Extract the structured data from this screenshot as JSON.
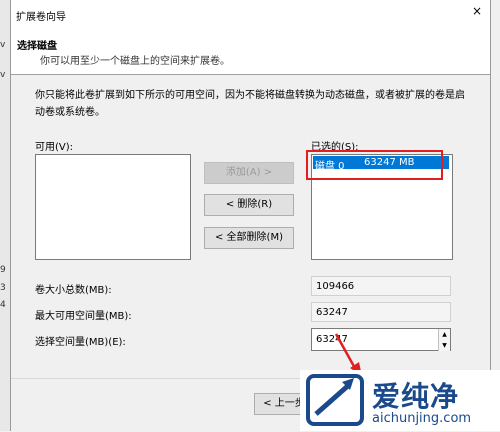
{
  "window": {
    "title": "扩展卷向导",
    "close_glyph": "×"
  },
  "header": {
    "title": "选择磁盘",
    "subtitle": "你可以用至少一个磁盘上的空间来扩展卷。"
  },
  "description": "你只能将此卷扩展到如下所示的可用空间，因为不能将磁盘转换为动态磁盘，或者被扩展的卷是启动卷或系统卷。",
  "available": {
    "label": "可用(V):",
    "items": []
  },
  "selected": {
    "label": "已选的(S):",
    "items": [
      {
        "disk": "磁盘 0",
        "size": "63247 MB"
      }
    ]
  },
  "buttons": {
    "add": "添加(A) >",
    "remove": "< 删除(R)",
    "remove_all": "< 全部删除(M)",
    "back": "< 上一步"
  },
  "fields": {
    "total_label": "卷大小总数(MB):",
    "total_value": "109466",
    "max_label": "最大可用空间量(MB):",
    "max_value": "63247",
    "select_label": "选择空间量(MB)(E):",
    "select_value": "63247"
  },
  "background_fragments": [
    "v",
    "v",
    "9",
    "3",
    "4"
  ],
  "watermark": {
    "brand": "爱纯净",
    "url": "aichunjing.com"
  },
  "colors": {
    "selection": "#0078d7",
    "highlight_box": "#e02020",
    "arrow": "#e02020",
    "watermark": "#1a4a8c"
  }
}
